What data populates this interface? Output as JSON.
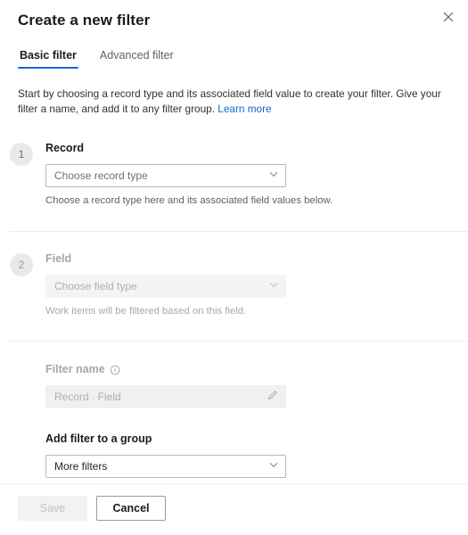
{
  "dialog": {
    "title": "Create a new filter",
    "close_icon": "close-icon"
  },
  "tabs": [
    {
      "label": "Basic filter",
      "selected": true
    },
    {
      "label": "Advanced filter",
      "selected": false
    }
  ],
  "intro": {
    "text": "Start by choosing a record type and its associated field value to create your filter. Give your filter a name, and add it to any filter group.",
    "link_label": "Learn more"
  },
  "steps": [
    {
      "number": "1",
      "label": "Record",
      "dropdown_text": "Choose record type",
      "helper": "Choose a record type here and its associated field values below.",
      "disabled": false
    },
    {
      "number": "2",
      "label": "Field",
      "dropdown_text": "Choose field type",
      "helper": "Work items will be filtered based on this field.",
      "disabled": true
    }
  ],
  "filter_name": {
    "label": "Filter name",
    "info_icon": "info-icon",
    "input_placeholder": "Record . Field",
    "input_value": "",
    "edit_icon": "pencil-icon"
  },
  "filter_group": {
    "label": "Add filter to a group",
    "selected_option": "More filters"
  },
  "footer": {
    "save_label": "Save",
    "cancel_label": "Cancel"
  },
  "colors": {
    "accent": "#1567d3",
    "link": "#1567d3",
    "badge_bg": "#e9e9e9",
    "disabled_field_bg": "#f4f4f4",
    "divider": "#ededed"
  }
}
